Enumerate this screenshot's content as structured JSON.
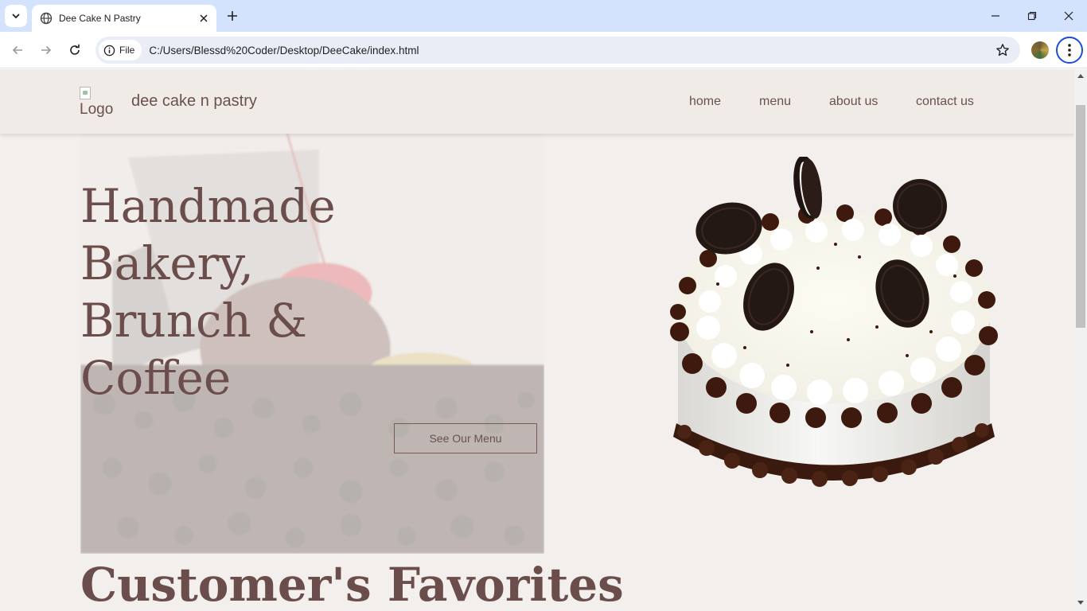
{
  "browser": {
    "tab_title": "Dee Cake N Pastry",
    "omnibox_chip": "File",
    "url": "C:/Users/Blessd%20Coder/Desktop/DeeCake/index.html"
  },
  "site": {
    "logo_alt": "Logo",
    "brand_name": "dee cake n pastry",
    "nav": [
      "home",
      "menu",
      "about us",
      "contact us"
    ],
    "hero": {
      "title_lines": [
        "Handmade",
        "Bakery,",
        "Brunch &",
        "Coffee"
      ],
      "cta_label": "See Our Menu"
    },
    "section_title": "Customer's Favorites"
  },
  "colors": {
    "page_background": "#f3efec",
    "header_background": "#f0ebe7",
    "brand_text": "#6b5050",
    "heading_text": "#6b4e4b",
    "tabstrip": "#d3e3fd"
  }
}
